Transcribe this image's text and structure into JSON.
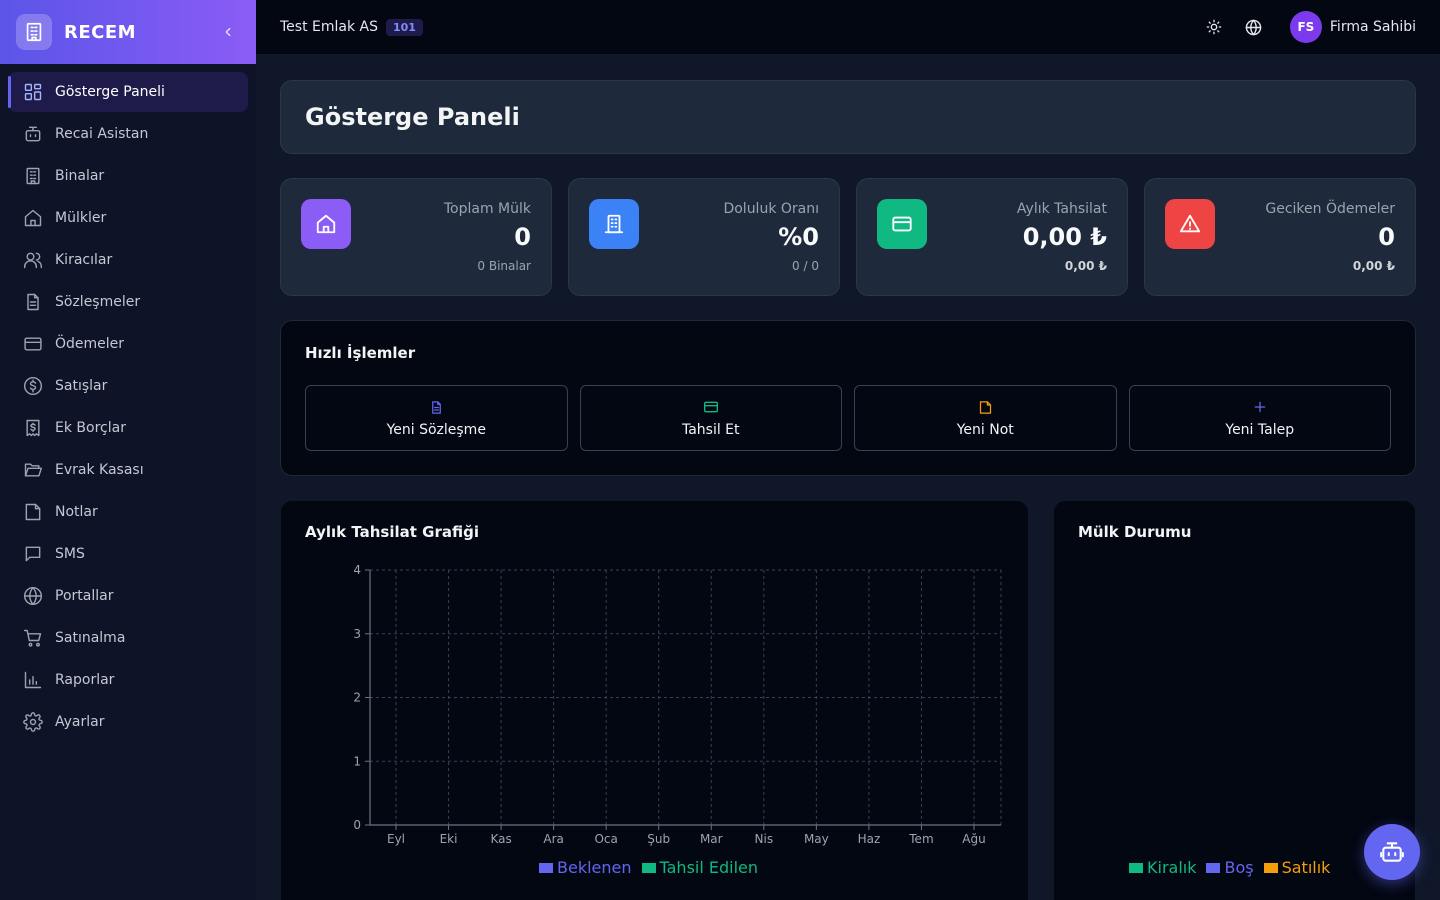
{
  "brand": {
    "name": "RECEM",
    "logo_icon": "building-icon",
    "collapse_icon": "chevron-left-icon"
  },
  "sidebar": {
    "items": [
      {
        "label": "Gösterge Paneli",
        "icon": "dashboard-icon",
        "active": true
      },
      {
        "label": "Recai Asistan",
        "icon": "bot-icon"
      },
      {
        "label": "Binalar",
        "icon": "building-icon"
      },
      {
        "label": "Mülkler",
        "icon": "home-icon"
      },
      {
        "label": "Kiracılar",
        "icon": "users-icon"
      },
      {
        "label": "Sözleşmeler",
        "icon": "file-text-icon"
      },
      {
        "label": "Ödemeler",
        "icon": "credit-card-icon"
      },
      {
        "label": "Satışlar",
        "icon": "dollar-circle-icon"
      },
      {
        "label": "Ek Borçlar",
        "icon": "receipt-icon"
      },
      {
        "label": "Evrak Kasası",
        "icon": "folder-open-icon"
      },
      {
        "label": "Notlar",
        "icon": "sticky-note-icon"
      },
      {
        "label": "SMS",
        "icon": "message-icon"
      },
      {
        "label": "Portallar",
        "icon": "globe-icon"
      },
      {
        "label": "Satınalma",
        "icon": "cart-icon"
      },
      {
        "label": "Raporlar",
        "icon": "bar-chart-icon"
      },
      {
        "label": "Ayarlar",
        "icon": "settings-icon"
      }
    ]
  },
  "topbar": {
    "company": "Test Emlak AS",
    "company_badge": "101",
    "theme_icon": "sun-icon",
    "language_icon": "globe-icon",
    "user_initials": "FS",
    "user_name": "Firma Sahibi"
  },
  "page": {
    "title": "Gösterge Paneli"
  },
  "stats": [
    {
      "label": "Toplam Mülk",
      "value": "0",
      "sub": "0 Binalar",
      "icon": "home-icon",
      "color": "#8b5cf6"
    },
    {
      "label": "Doluluk Oranı",
      "value": "%0",
      "sub": "0 / 0",
      "icon": "building-icon",
      "color": "#3b82f6"
    },
    {
      "label": "Aylık Tahsilat",
      "value": "0,00 ₺",
      "sub": "0,00 ₺",
      "icon": "credit-card-icon",
      "color": "#10b981"
    },
    {
      "label": "Geciken Ödemeler",
      "value": "0",
      "sub": "0,00 ₺",
      "icon": "alert-triangle-icon",
      "color": "#ef4444"
    }
  ],
  "quick_actions": {
    "title": "Hızlı İşlemler",
    "items": [
      {
        "label": "Yeni Sözleşme",
        "icon": "file-text-icon",
        "color": "#6366f1"
      },
      {
        "label": "Tahsil Et",
        "icon": "credit-card-icon",
        "color": "#10b981"
      },
      {
        "label": "Yeni Not",
        "icon": "sticky-note-icon",
        "color": "#f59e0b"
      },
      {
        "label": "Yeni Talep",
        "icon": "plus-icon",
        "color": "#6366f1"
      }
    ]
  },
  "chart_data": [
    {
      "type": "bar",
      "title": "Aylık Tahsilat Grafiği",
      "categories": [
        "Eyl",
        "Eki",
        "Kas",
        "Ara",
        "Oca",
        "Şub",
        "Mar",
        "Nis",
        "May",
        "Haz",
        "Tem",
        "Ağu"
      ],
      "series": [
        {
          "name": "Beklenen",
          "values": [
            0,
            0,
            0,
            0,
            0,
            0,
            0,
            0,
            0,
            0,
            0,
            0
          ],
          "color": "#6366f1"
        },
        {
          "name": "Tahsil Edilen",
          "values": [
            0,
            0,
            0,
            0,
            0,
            0,
            0,
            0,
            0,
            0,
            0,
            0
          ],
          "color": "#10b981"
        }
      ],
      "ylim": [
        0,
        4
      ],
      "yticks": [
        "0",
        "1",
        "2",
        "3",
        "4"
      ],
      "grid": true,
      "legend": "bottom"
    },
    {
      "type": "pie",
      "title": "Mülk Durumu",
      "categories": [
        "Kiralık",
        "Boş",
        "Satılık"
      ],
      "values": [
        0,
        0,
        0
      ],
      "colors": [
        "#10b981",
        "#6366f1",
        "#f59e0b"
      ],
      "legend": "bottom"
    }
  ],
  "fab": {
    "icon": "bot-icon"
  }
}
